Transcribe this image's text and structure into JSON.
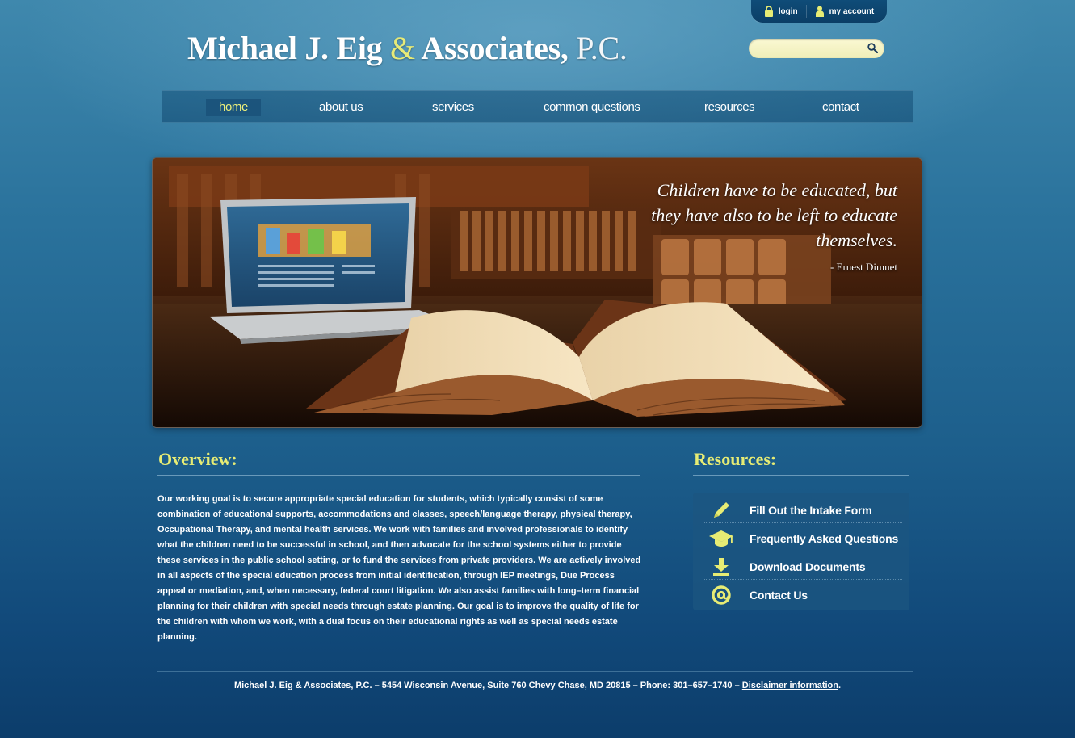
{
  "account": {
    "login_label": "login",
    "my_account_label": "my account"
  },
  "header": {
    "logo_name": "Michael J. Eig",
    "logo_amp": "&",
    "logo_assoc": "Associates,",
    "logo_pc": "P.C.",
    "search_value": ""
  },
  "nav": {
    "items": [
      "home",
      "about us",
      "services",
      "common questions",
      "resources",
      "contact"
    ],
    "active": "home"
  },
  "hero": {
    "quote": "Children have to be educated, but they have also to be left to educate themselves.",
    "author": "- Ernest Dimnet"
  },
  "overview": {
    "title": "Overview:",
    "text": "Our working goal is to secure appropriate special education for students, which typically consist of some combination of educational supports, accommodations and classes, speech/language therapy, physical therapy, Occupational Therapy, and mental health services. We work with families and involved professionals to identify what the children need to be successful in school, and then advocate for the school systems either to provide these services in the public school setting, or to fund the services from private providers. We are actively involved in all aspects of the special education process from initial identification, through IEP meetings, Due Process appeal or mediation, and, when necessary, federal court litigation. We also assist families with long–term financial planning for their children with special needs through estate planning. Our goal is to improve the quality of life for the children with whom we work, with a dual focus on their educational rights as well as special needs estate planning."
  },
  "resources": {
    "title": "Resources:",
    "items": [
      {
        "label": "Fill Out the Intake Form",
        "icon": "pencil-icon"
      },
      {
        "label": "Frequently Asked Questions",
        "icon": "graduation-cap-icon"
      },
      {
        "label": "Download Documents",
        "icon": "download-icon"
      },
      {
        "label": "Contact Us",
        "icon": "at-sign-icon"
      }
    ]
  },
  "footer": {
    "text": "Michael J. Eig & Associates, P.C. – 5454 Wisconsin Avenue, Suite 760 Chevy Chase, MD 20815 – Phone: 301–657–1740 – ",
    "disclaimer": "Disclaimer information",
    "end": "."
  },
  "colors": {
    "accent_yellow": "#e7ec74",
    "background_blue": "#1d5f8c"
  }
}
